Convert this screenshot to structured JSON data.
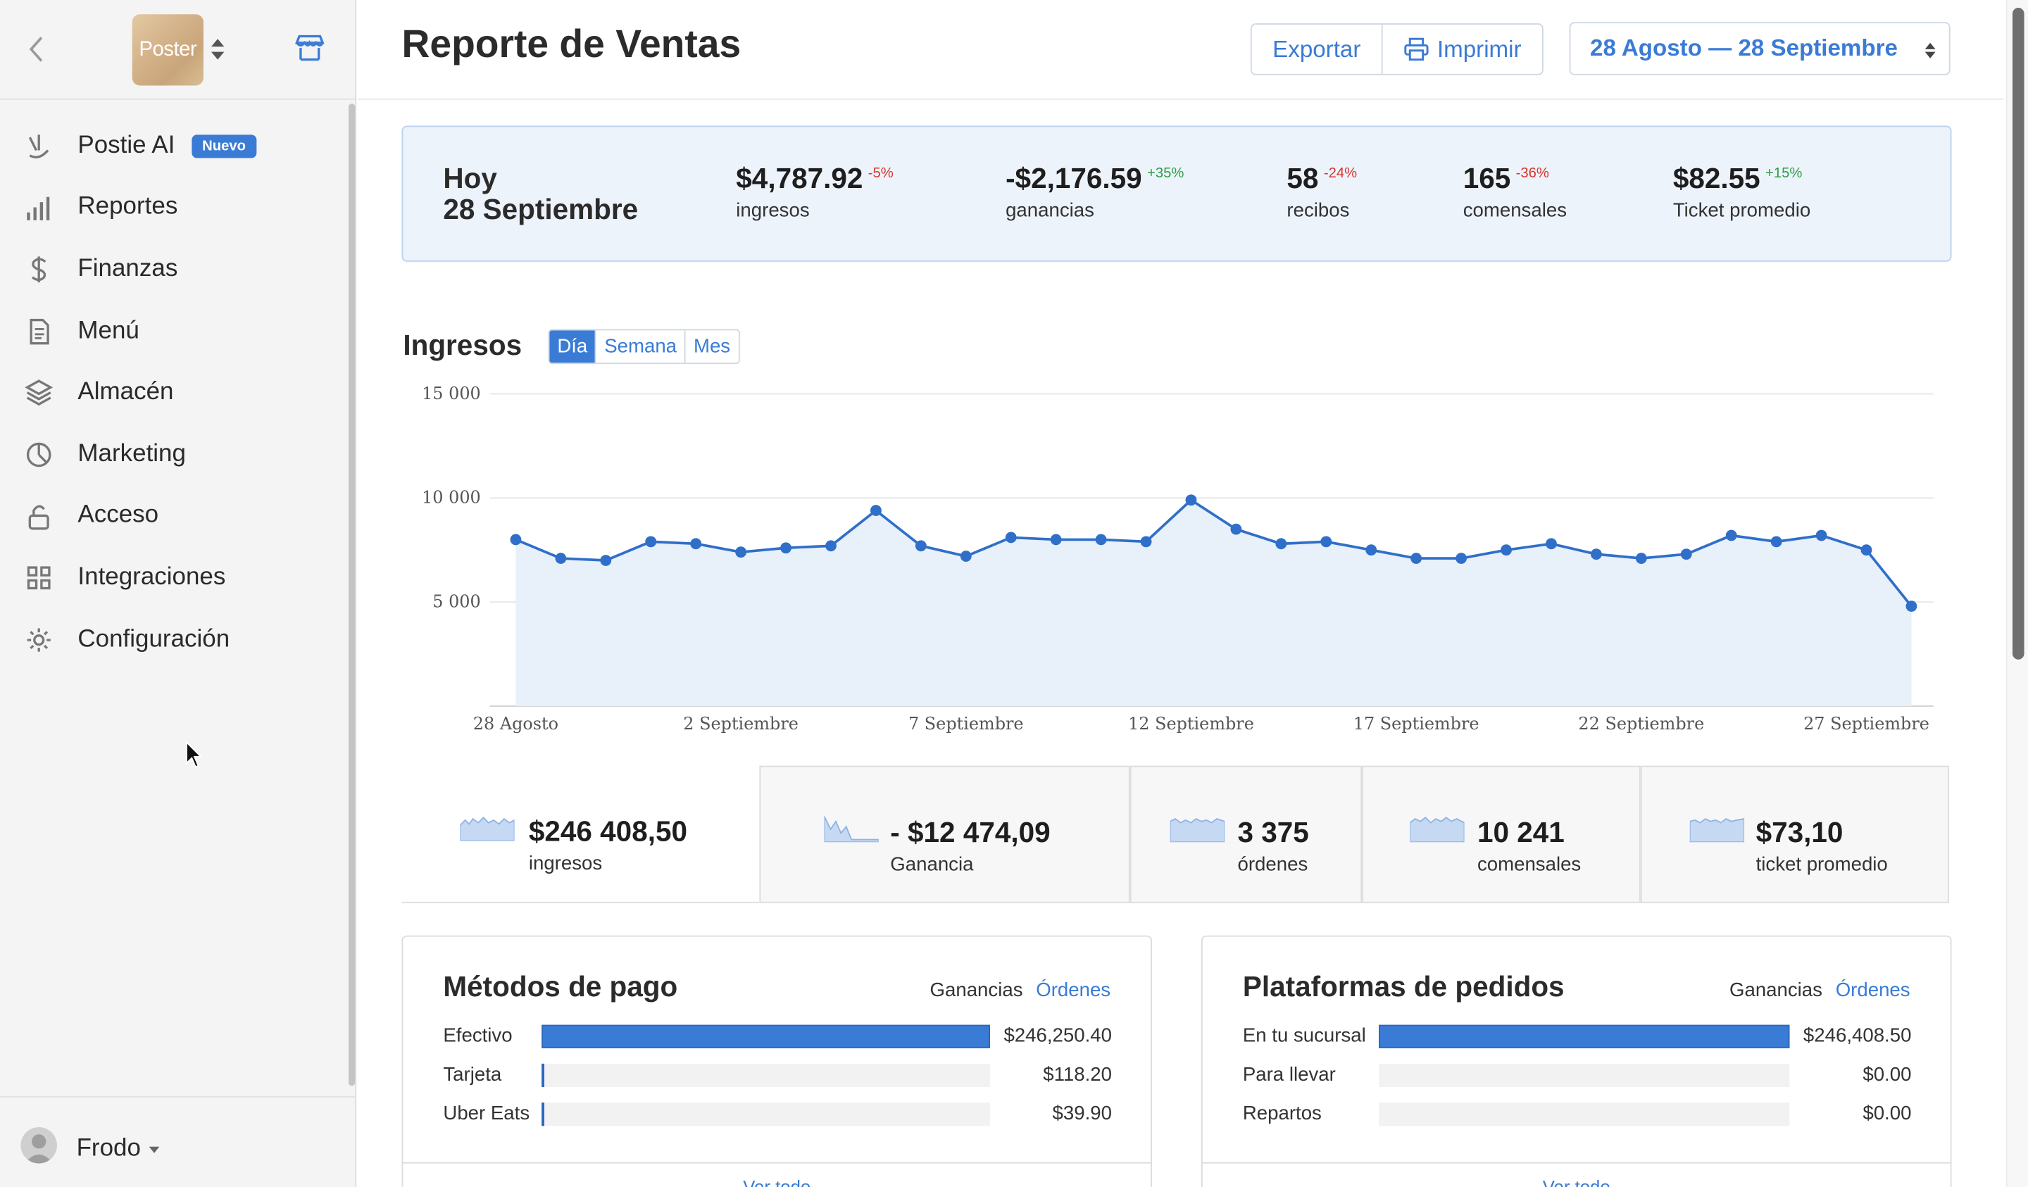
{
  "sidebar": {
    "logo_text": "Poster",
    "items": [
      {
        "label": "Postie AI",
        "icon": "ai-icon",
        "badge": "Nuevo"
      },
      {
        "label": "Reportes",
        "icon": "bar-chart-icon"
      },
      {
        "label": "Finanzas",
        "icon": "dollar-icon"
      },
      {
        "label": "Menú",
        "icon": "document-icon"
      },
      {
        "label": "Almacén",
        "icon": "layers-icon"
      },
      {
        "label": "Marketing",
        "icon": "pie-icon"
      },
      {
        "label": "Acceso",
        "icon": "lock-icon"
      },
      {
        "label": "Integraciones",
        "icon": "grid-icon"
      },
      {
        "label": "Configuración",
        "icon": "gear-icon"
      }
    ],
    "user": "Frodo"
  },
  "header": {
    "title": "Reporte de Ventas",
    "export_label": "Exportar",
    "print_label": "Imprimir",
    "date_range": "28 Agosto — 28 Septiembre"
  },
  "today": {
    "title_line1": "Hoy",
    "title_line2": "28 Septiembre",
    "kpis": [
      {
        "value": "$4,787.92",
        "delta": "-5%",
        "label": "ingresos",
        "trend": "neg"
      },
      {
        "value": "-$2,176.59",
        "delta": "+35%",
        "label": "ganancias",
        "trend": "pos"
      },
      {
        "value": "58",
        "delta": "-24%",
        "label": "recibos",
        "trend": "neg"
      },
      {
        "value": "165",
        "delta": "-36%",
        "label": "comensales",
        "trend": "neg"
      },
      {
        "value": "$82.55",
        "delta": "+15%",
        "label": "Ticket promedio",
        "trend": "pos"
      }
    ]
  },
  "revenue": {
    "title": "Ingresos",
    "periods": [
      "Día",
      "Semana",
      "Mes"
    ],
    "active_period": "Día"
  },
  "chart_data": {
    "type": "area",
    "title": "Ingresos",
    "xlabel": "",
    "ylabel": "",
    "ylim": [
      0,
      15000
    ],
    "yticks": [
      5000,
      10000,
      15000
    ],
    "ytick_labels": [
      "5 000",
      "10 000",
      "15 000"
    ],
    "xtick_labels": [
      "28 Agosto",
      "2 Septiembre",
      "7 Septiembre",
      "12 Septiembre",
      "17 Septiembre",
      "22 Septiembre",
      "27 Septiembre"
    ],
    "xtick_positions": [
      0,
      5,
      10,
      15,
      20,
      25,
      30
    ],
    "grid": true,
    "color": "#2f6fc9",
    "values": [
      8000,
      7100,
      7000,
      7900,
      7800,
      7400,
      7600,
      7700,
      9400,
      7700,
      7200,
      8100,
      8000,
      8000,
      7900,
      9900,
      8500,
      7800,
      7900,
      7500,
      7100,
      7100,
      7500,
      7800,
      7300,
      7100,
      7300,
      8200,
      7900,
      8200,
      7500,
      4800
    ]
  },
  "totals": [
    {
      "value": "$246 408,50",
      "label": "ingresos",
      "spark": "flat"
    },
    {
      "value": "- $12 474,09",
      "label": "Ganancia",
      "spark": "drop"
    },
    {
      "value": "3 375",
      "label": "órdenes",
      "spark": "flat"
    },
    {
      "value": "10 241",
      "label": "comensales",
      "spark": "flat"
    },
    {
      "value": "$73,10",
      "label": "ticket promedio",
      "spark": "flat"
    }
  ],
  "payments": {
    "title": "Métodos de pago",
    "toggle_a": "Ganancias",
    "toggle_b": "Órdenes",
    "rows": [
      {
        "label": "Efectivo",
        "value": "$246,250.40",
        "fraction": 1.0
      },
      {
        "label": "Tarjeta",
        "value": "$118.20",
        "fraction": 0.005
      },
      {
        "label": "Uber Eats",
        "value": "$39.90",
        "fraction": 0.005
      }
    ],
    "footer": "Ver todo"
  },
  "platforms": {
    "title": "Plataformas de pedidos",
    "toggle_a": "Ganancias",
    "toggle_b": "Órdenes",
    "rows": [
      {
        "label": "En tu sucursal",
        "value": "$246,408.50",
        "fraction": 1.0
      },
      {
        "label": "Para llevar",
        "value": "$0.00",
        "fraction": 0
      },
      {
        "label": "Repartos",
        "value": "$0.00",
        "fraction": 0
      }
    ],
    "footer": "Ver todo"
  }
}
